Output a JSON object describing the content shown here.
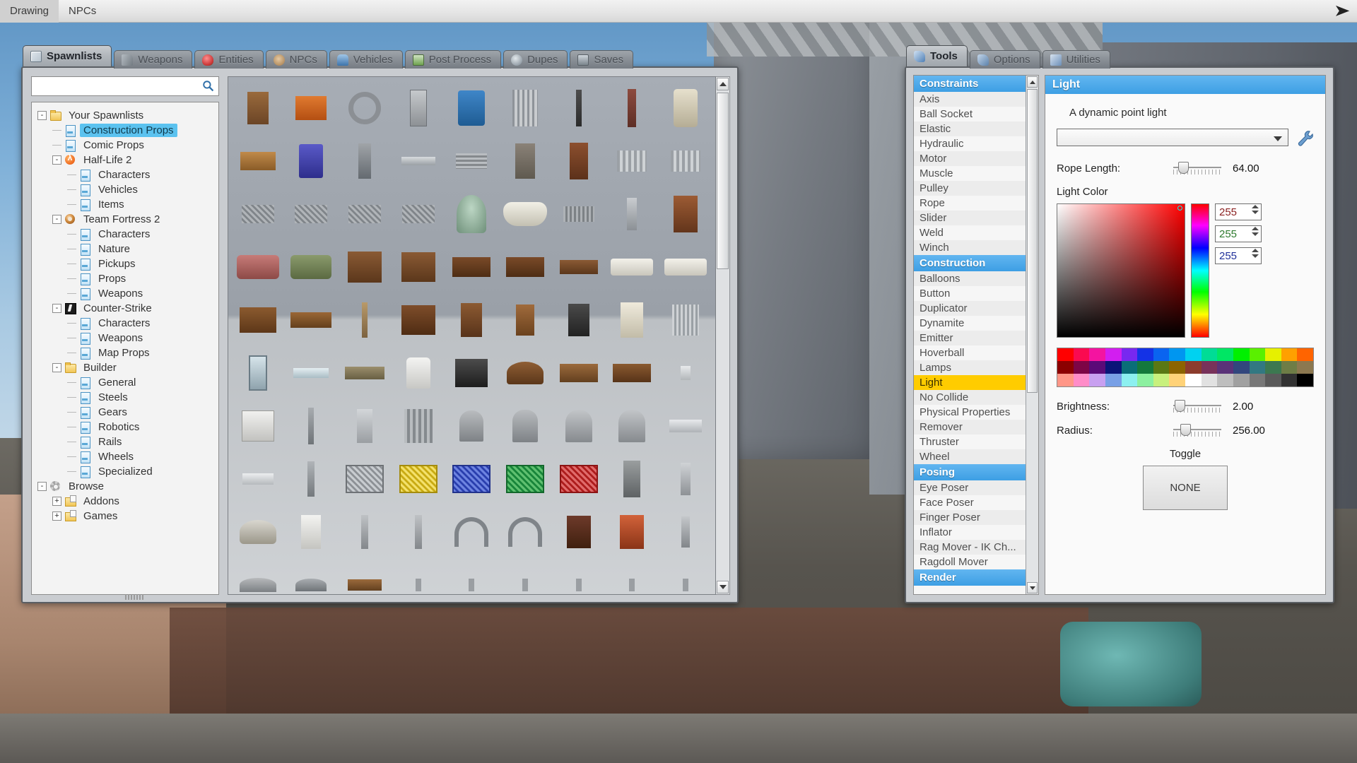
{
  "menubar": {
    "items": [
      {
        "label": "Drawing"
      },
      {
        "label": "NPCs"
      }
    ],
    "collapse_icon": "chevron-right-icon"
  },
  "spawnmenu": {
    "tabs": [
      {
        "label": "Spawnlists",
        "icon": "spawnlist-grid-icon",
        "active": true
      },
      {
        "label": "Weapons",
        "icon": "weapon-icon",
        "active": false
      },
      {
        "label": "Entities",
        "icon": "entity-flower-icon",
        "active": false
      },
      {
        "label": "NPCs",
        "icon": "npc-face-icon",
        "active": false
      },
      {
        "label": "Vehicles",
        "icon": "vehicle-car-icon",
        "active": false
      },
      {
        "label": "Post Process",
        "icon": "post-process-icon",
        "active": false
      },
      {
        "label": "Dupes",
        "icon": "dupes-icon",
        "active": false
      },
      {
        "label": "Saves",
        "icon": "saves-floppy-icon",
        "active": false
      }
    ],
    "search": {
      "value": "",
      "placeholder": "",
      "icon": "search-icon"
    },
    "tree": [
      {
        "label": "Your Spawnlists",
        "depth": 0,
        "icon": "folder-icon",
        "expander": "-",
        "selected": false
      },
      {
        "label": "Construction Props",
        "depth": 1,
        "icon": "page-icon",
        "expander": "",
        "selected": true
      },
      {
        "label": "Comic Props",
        "depth": 1,
        "icon": "page-icon",
        "expander": "",
        "selected": false
      },
      {
        "label": "Half-Life 2",
        "depth": 1,
        "icon": "halflife2-icon",
        "expander": "-",
        "selected": false
      },
      {
        "label": "Characters",
        "depth": 2,
        "icon": "page-icon",
        "expander": "",
        "selected": false
      },
      {
        "label": "Vehicles",
        "depth": 2,
        "icon": "page-icon",
        "expander": "",
        "selected": false
      },
      {
        "label": "Items",
        "depth": 2,
        "icon": "page-icon",
        "expander": "",
        "selected": false
      },
      {
        "label": "Team Fortress 2",
        "depth": 1,
        "icon": "teamfortress2-icon",
        "expander": "-",
        "selected": false
      },
      {
        "label": "Characters",
        "depth": 2,
        "icon": "page-icon",
        "expander": "",
        "selected": false
      },
      {
        "label": "Nature",
        "depth": 2,
        "icon": "page-icon",
        "expander": "",
        "selected": false
      },
      {
        "label": "Pickups",
        "depth": 2,
        "icon": "page-icon",
        "expander": "",
        "selected": false
      },
      {
        "label": "Props",
        "depth": 2,
        "icon": "page-icon",
        "expander": "",
        "selected": false
      },
      {
        "label": "Weapons",
        "depth": 2,
        "icon": "page-icon",
        "expander": "",
        "selected": false
      },
      {
        "label": "Counter-Strike",
        "depth": 1,
        "icon": "counterstrike-icon",
        "expander": "-",
        "selected": false
      },
      {
        "label": "Characters",
        "depth": 2,
        "icon": "page-icon",
        "expander": "",
        "selected": false
      },
      {
        "label": "Weapons",
        "depth": 2,
        "icon": "page-icon",
        "expander": "",
        "selected": false
      },
      {
        "label": "Map Props",
        "depth": 2,
        "icon": "page-icon",
        "expander": "",
        "selected": false
      },
      {
        "label": "Builder",
        "depth": 1,
        "icon": "folder-icon",
        "expander": "-",
        "selected": false
      },
      {
        "label": "General",
        "depth": 2,
        "icon": "page-icon",
        "expander": "",
        "selected": false
      },
      {
        "label": "Steels",
        "depth": 2,
        "icon": "page-icon",
        "expander": "",
        "selected": false
      },
      {
        "label": "Gears",
        "depth": 2,
        "icon": "page-icon",
        "expander": "",
        "selected": false
      },
      {
        "label": "Robotics",
        "depth": 2,
        "icon": "page-icon",
        "expander": "",
        "selected": false
      },
      {
        "label": "Rails",
        "depth": 2,
        "icon": "page-icon",
        "expander": "",
        "selected": false
      },
      {
        "label": "Wheels",
        "depth": 2,
        "icon": "page-icon",
        "expander": "",
        "selected": false
      },
      {
        "label": "Specialized",
        "depth": 2,
        "icon": "page-icon",
        "expander": "",
        "selected": false
      },
      {
        "label": "Browse",
        "depth": 0,
        "icon": "gear-icon",
        "expander": "-",
        "selected": false
      },
      {
        "label": "Addons",
        "depth": 1,
        "icon": "folder-add-icon",
        "expander": "+",
        "selected": false
      },
      {
        "label": "Games",
        "depth": 1,
        "icon": "folder-add-icon",
        "expander": "+",
        "selected": false
      }
    ],
    "scrollbar": {
      "up_icon": "scroll-up-icon",
      "down_icon": "scroll-down-icon"
    }
  },
  "toolsmenu": {
    "tabs": [
      {
        "label": "Tools",
        "icon": "wrench-icon",
        "active": true
      },
      {
        "label": "Options",
        "icon": "wrench-icon",
        "active": false
      },
      {
        "label": "Utilities",
        "icon": "utilities-icon",
        "active": false
      }
    ],
    "categories": [
      {
        "name": "Constraints",
        "items": [
          "Axis",
          "Ball Socket",
          "Elastic",
          "Hydraulic",
          "Motor",
          "Muscle",
          "Pulley",
          "Rope",
          "Slider",
          "Weld",
          "Winch"
        ]
      },
      {
        "name": "Construction",
        "items": [
          "Balloons",
          "Button",
          "Duplicator",
          "Dynamite",
          "Emitter",
          "Hoverball",
          "Lamps",
          "Light",
          "No Collide",
          "Physical Properties",
          "Remover",
          "Thruster",
          "Wheel"
        ]
      },
      {
        "name": "Posing",
        "items": [
          "Eye Poser",
          "Face Poser",
          "Finger Poser",
          "Inflator",
          "Rag Mover - IK Ch...",
          "Ragdoll Mover"
        ]
      },
      {
        "name": "Render",
        "items": []
      }
    ],
    "selected_tool": "Light",
    "highlight_color": "#ffcc00"
  },
  "toolpanel": {
    "title": "Light",
    "description": "A dynamic point light",
    "preset": {
      "value": "",
      "placeholder": "",
      "dropdown_icon": "chevron-down-icon",
      "edit_icon": "wrench-icon"
    },
    "rope_length": {
      "label": "Rope Length:",
      "value": "64.00",
      "knob_pct": 18
    },
    "light_color": {
      "label": "Light Color",
      "r": "255",
      "g": "255",
      "b": "255",
      "hex": "#ffffff",
      "palette_row1": [
        "#ff0000",
        "#fa0a50",
        "#f414a0",
        "#d21ef0",
        "#7828f0",
        "#1432e6",
        "#0a64f0",
        "#0096f0",
        "#00d2f0",
        "#00dc96",
        "#00e664",
        "#00f000",
        "#5af000",
        "#e6f000",
        "#ffa000",
        "#ff6400"
      ],
      "palette_row2": [
        "#8c0000",
        "#7d0546",
        "#5a0a78",
        "#0a1478",
        "#0a6e78",
        "#14783c",
        "#5a7814",
        "#8c6400",
        "#8c3c2d",
        "#78325a",
        "#5a3278",
        "#32467d",
        "#327882",
        "#3c7850",
        "#6e7d46",
        "#8c7850"
      ],
      "palette_row3": [
        "#ff9687",
        "#ff8cc8",
        "#c8a0f0",
        "#78a0e6",
        "#8cf0f0",
        "#8cf0a0",
        "#c8f07d",
        "#ffd278",
        "#ffffff",
        "#e1e1e1",
        "#bebebe",
        "#a0a0a0",
        "#787878",
        "#5a5a5a",
        "#323232",
        "#000000"
      ]
    },
    "brightness": {
      "label": "Brightness:",
      "value": "2.00",
      "knob_pct": 8
    },
    "radius": {
      "label": "Radius:",
      "value": "256.00",
      "knob_pct": 22
    },
    "toggle": {
      "label": "Toggle",
      "button_label": "NONE"
    }
  }
}
